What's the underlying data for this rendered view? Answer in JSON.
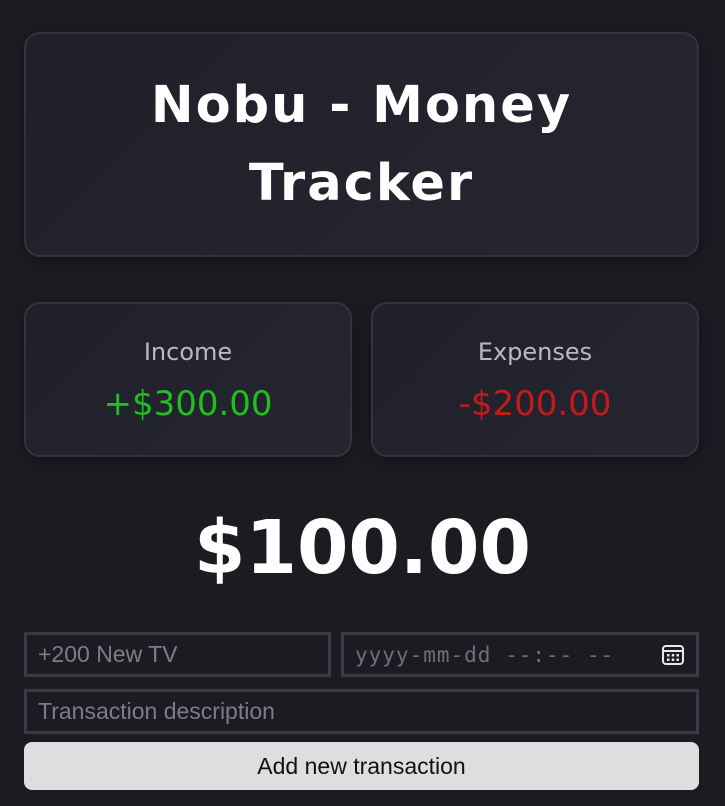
{
  "header": {
    "title": "Nobu - Money Tracker"
  },
  "summary": {
    "income_label": "Income",
    "income_value": "+$300.00",
    "expenses_label": "Expenses",
    "expenses_value": "-$200.00",
    "balance": "$100.00"
  },
  "form": {
    "amount_placeholder": "+200 New TV",
    "datetime_placeholder": "yyyy-mm-dd --:-- --",
    "description_placeholder": "Transaction description",
    "submit_label": "Add new transaction"
  },
  "icons": {
    "calendar": "calendar-icon"
  },
  "colors": {
    "background": "#1b1b22",
    "income": "#1fbf1f",
    "expenses": "#c61a1a",
    "button": "#dedede"
  }
}
